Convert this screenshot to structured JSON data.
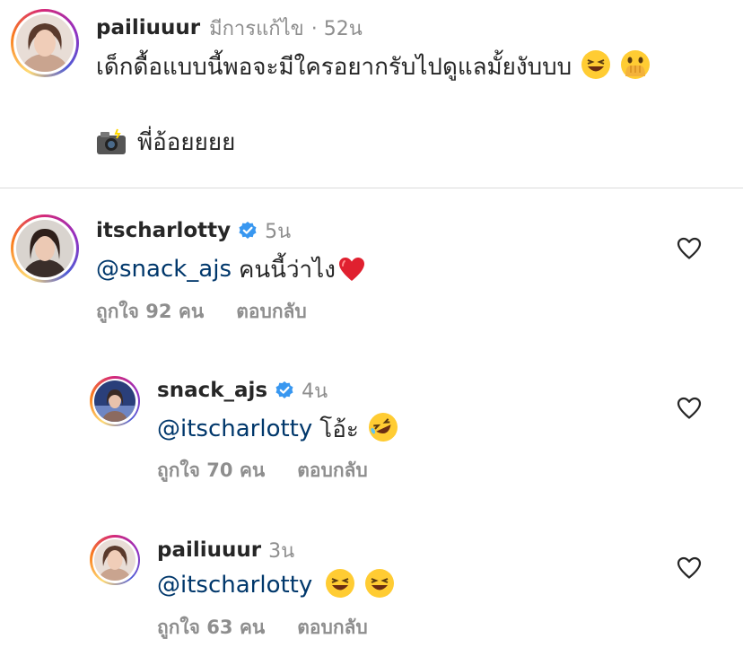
{
  "caption": {
    "username": "pailiuuur",
    "edited": "มีการแก้ไข",
    "time": "· 52น",
    "line1": "เด็กดื้อแบบนี้พอจะมีใครอยากรับไปดูแลมั้ยงับบบ",
    "line2": "พี่อ้อยยยย",
    "emojis": [
      "grinning-squinting-face",
      "face-with-hand-over-mouth",
      "camera-with-flash"
    ]
  },
  "comments": [
    {
      "username": "itscharlotty",
      "verified": true,
      "time": "5น",
      "mention": "@snack_ajs",
      "text": "คนนี้ว่าไง",
      "emoji": "red-heart",
      "likes": "ถูกใจ 92 คน",
      "reply": "ตอบกลับ"
    },
    {
      "username": "snack_ajs",
      "verified": true,
      "time": "4น",
      "mention": "@itscharlotty",
      "text": "โอ้ะ",
      "emoji": "rolling-on-floor-laughing",
      "likes": "ถูกใจ 70 คน",
      "reply": "ตอบกลับ"
    },
    {
      "username": "pailiuuur",
      "verified": false,
      "time": "3น",
      "mention": "@itscharlotty",
      "text": "",
      "emoji": "grinning-squinting-face x2",
      "likes": "ถูกใจ 63 คน",
      "reply": "ตอบกลับ"
    }
  ],
  "colors": {
    "mention": "#00376b",
    "muted": "#8e8e8e",
    "verified": "#3897f0",
    "text": "#262626"
  }
}
